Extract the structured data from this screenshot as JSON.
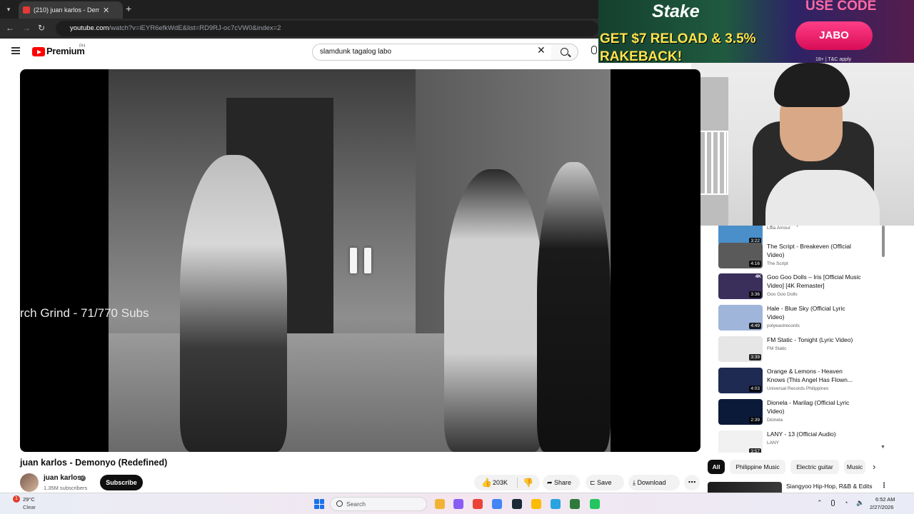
{
  "browser": {
    "tab_title": "(210) juan karlos - Demony",
    "tab_close": "✕",
    "new_tab": "+",
    "url_site": "youtube.com",
    "url_path": "/watch?v=iEYR6efkWdE&list=RD9RJ-oc7cVW0&index=2"
  },
  "youtube": {
    "logo_text": "Premium",
    "region": "PH",
    "search_value": "slamdunk tagalog labo"
  },
  "video": {
    "overlay_text": "rch Grind - 71/770 Subs",
    "title": "juan karlos - Demonyo (Redefined)",
    "channel_name": "juan karlos",
    "subscribers": "1.35M subscribers",
    "subscribe_label": "Subscribe",
    "like_count": "203K",
    "share_label": "Share",
    "save_label": "Save",
    "download_label": "Download"
  },
  "playlist": [
    {
      "title": "Lyric Video)",
      "channel": "Lola Amour",
      "duration": "3:22",
      "badge": "",
      "thumb_color": "#4a8fc9"
    },
    {
      "title": "The Script - Breakeven (Official Video)",
      "channel": "The Script",
      "duration": "4:16",
      "badge": "",
      "thumb_color": "#5a5a5a"
    },
    {
      "title": "Goo Goo Dolls – Iris [Official Music Video] [4K Remaster]",
      "channel": "Goo Goo Dolls",
      "duration": "3:36",
      "badge": "4K",
      "thumb_color": "#3a2f5a"
    },
    {
      "title": "Hale - Blue Sky (Official Lyric Video)",
      "channel": "polyeastrecords",
      "duration": "4:49",
      "badge": "",
      "thumb_color": "#9fb6da"
    },
    {
      "title": "FM Static - Tonight (Lyric Video)",
      "channel": "FM Static",
      "duration": "3:39",
      "badge": "",
      "thumb_color": "#e6e6e6"
    },
    {
      "title": "Orange & Lemons - Heaven Knows (This Angel Has Flown...",
      "channel": "Universal Records Philippines",
      "duration": "4:03",
      "badge": "",
      "thumb_color": "#1e2a52"
    },
    {
      "title": "Dionela - Marilag (Official Lyric Video)",
      "channel": "Dionela",
      "duration": "2:39",
      "badge": "",
      "thumb_color": "#0c1a3a"
    },
    {
      "title": "LANY - 13 (Official Audio)",
      "channel": "LANY",
      "duration": "3:57",
      "badge": "",
      "thumb_color": "#f1f1f1"
    }
  ],
  "chips": [
    "All",
    "Philippine Music",
    "Electric guitar",
    "Music"
  ],
  "recommendation": {
    "title": "Siangyoo Hip-Hop, R&B & Edits"
  },
  "ad": {
    "brand": "Stake",
    "headline": "GET $7 RELOAD & 3.5% RAKEBACK!",
    "use_code": "USE CODE",
    "code": "JABO",
    "terms": "18+ | T&C apply"
  },
  "taskbar": {
    "weather_badge": "1",
    "temp": "29°C",
    "condition": "Clear",
    "search_label": "Search",
    "time": "6:52 AM",
    "date": "2/27/2026",
    "apps": [
      "#f2b233",
      "#8a5cf6",
      "#ea4335",
      "#4285f4",
      "#1b2838",
      "#fbbc05",
      "#2aa3df",
      "#2f7a3a",
      "#22c55e"
    ]
  }
}
